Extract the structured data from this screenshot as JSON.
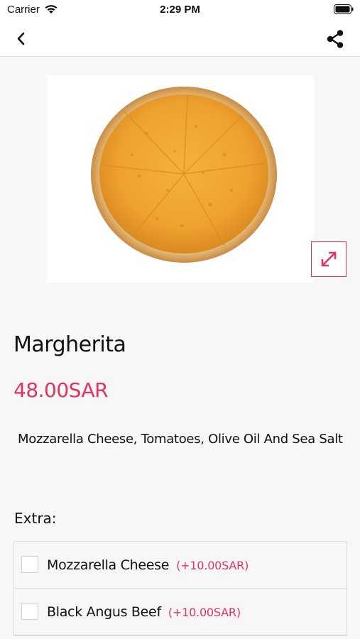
{
  "status_bar": {
    "carrier": "Carrier",
    "time": "2:29 PM"
  },
  "nav": {
    "back_icon": "chevron-left-icon",
    "share_icon": "share-icon"
  },
  "product": {
    "image_alt": "pizza-image",
    "name": "Margherita",
    "price": "48.00SAR",
    "description": "Mozzarella Cheese, Tomatoes, Olive Oil And Sea Salt"
  },
  "extras": {
    "heading": "Extra:",
    "items": [
      {
        "name": "Mozzarella Cheese",
        "price": "(+10.00SAR)",
        "checked": false
      },
      {
        "name": "Black Angus Beef",
        "price": "(+10.00SAR)",
        "checked": false
      }
    ]
  },
  "colors": {
    "accent": "#e2325f",
    "background": "#f7f7f7"
  }
}
